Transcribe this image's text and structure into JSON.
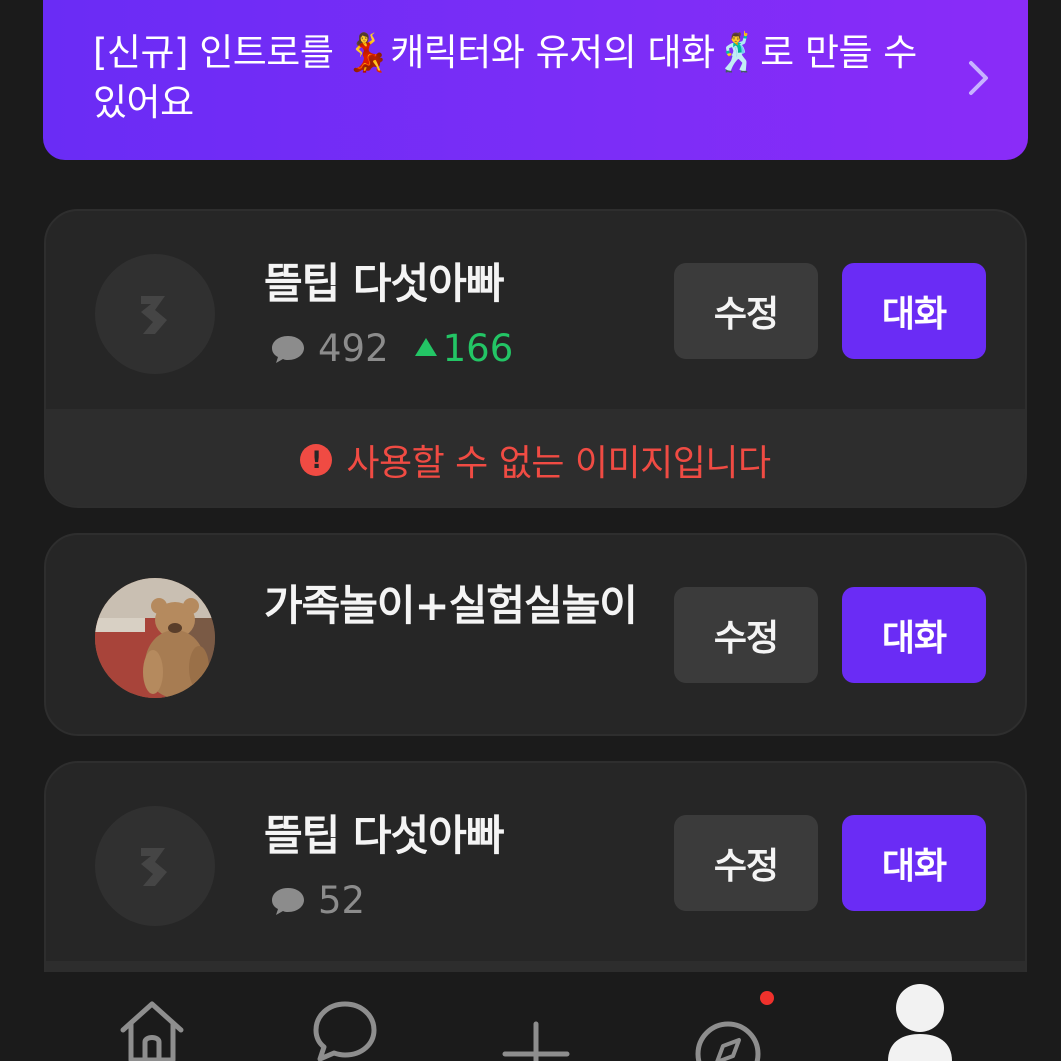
{
  "banner": {
    "text": "[신규] 인트로를 💃캐릭터와 유저의 대화🕺로 만들 수 있어요"
  },
  "characters": [
    {
      "name": "뜰팁 다섯아빠",
      "chat_count": "492",
      "trend": "166",
      "edit_label": "수정",
      "chat_label": "대화",
      "warning": "사용할 수 없는 이미지입니다"
    },
    {
      "name": "가족놀이+실험실놀이",
      "edit_label": "수정",
      "chat_label": "대화"
    },
    {
      "name": "뜰팁 다섯아빠",
      "chat_count": "52",
      "edit_label": "수정",
      "chat_label": "대화"
    }
  ],
  "nav": {
    "items": [
      "home-icon",
      "chat-icon",
      "plus-icon",
      "compass-icon",
      "profile-icon"
    ],
    "active": "profile-icon"
  },
  "colors": {
    "accent": "#6a2cf5",
    "trend": "#23c565",
    "warning": "#f04b43"
  }
}
